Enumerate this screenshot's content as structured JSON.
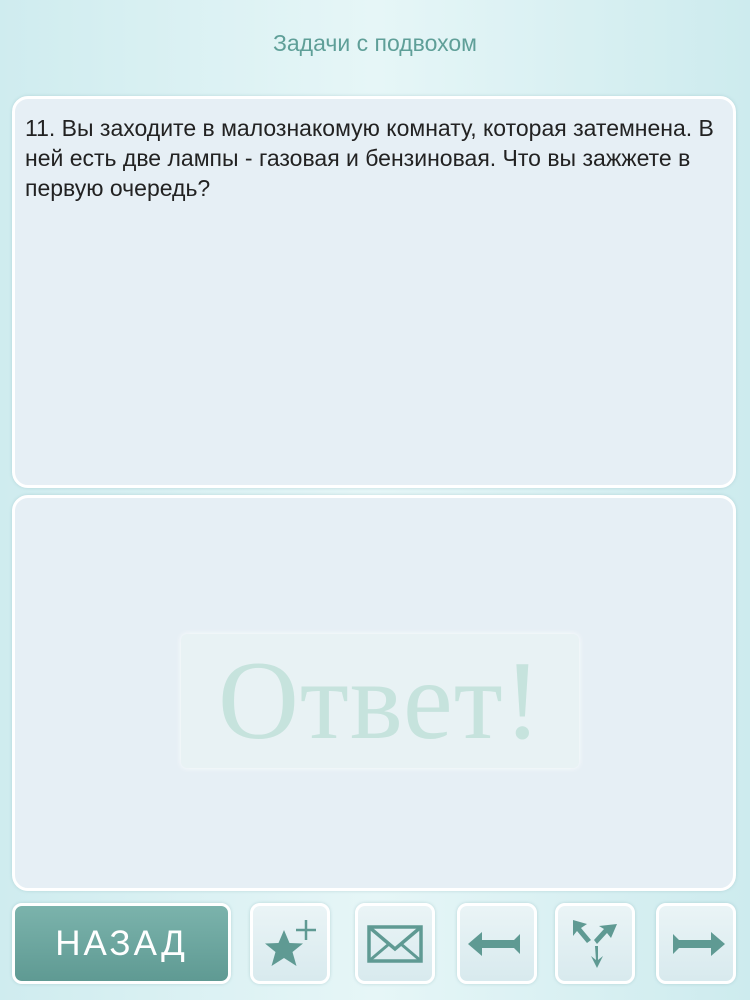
{
  "header": {
    "title": "Задачи с подвохом"
  },
  "question": {
    "text": "11. Вы заходите в малознакомую комнату, которая затемнена. В ней есть две лампы - газовая и бензиновая. Что вы зажжете в первую очередь?"
  },
  "answer": {
    "button_label": "Ответ!"
  },
  "toolbar": {
    "back_label": "НАЗАД",
    "icons": {
      "favorite": "star-plus-icon",
      "mail": "envelope-icon",
      "prev": "arrow-left-icon",
      "random": "shuffle-icon",
      "next": "arrow-right-icon"
    }
  },
  "colors": {
    "accent": "#5f9a93",
    "title_text": "#5f9f98",
    "panel_bg": "#e6eff5",
    "answer_text": "#c6e3dd"
  }
}
